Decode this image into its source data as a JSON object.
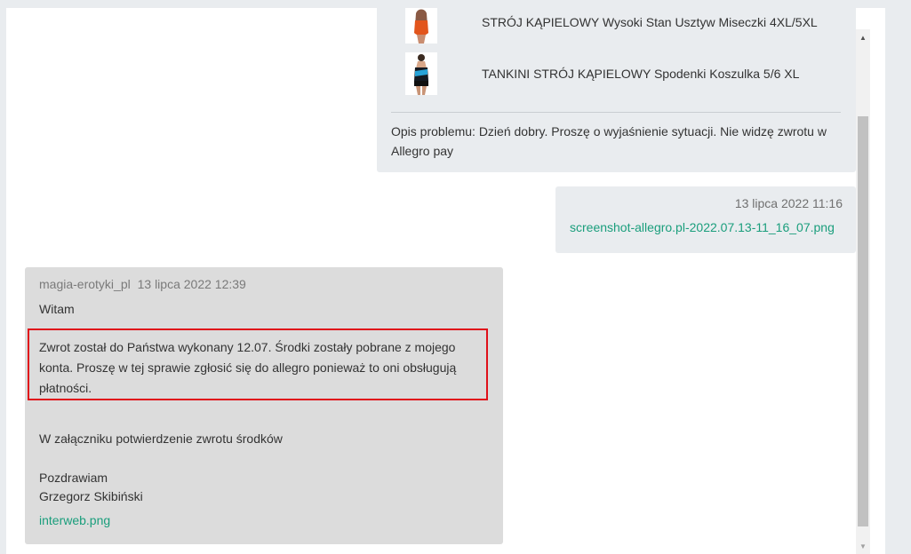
{
  "thread": {
    "buyer_message": {
      "products": [
        {
          "name": "STRÓJ KĄPIELOWY Wysoki Stan Usztyw Miseczki 4XL/5XL",
          "thumb_icon": "swimsuit-orange-thumbnail"
        },
        {
          "name": "TANKINI STRÓJ KĄPIELOWY Spodenki Koszulka 5/6 XL",
          "thumb_icon": "tankini-blue-thumbnail"
        }
      ],
      "problem_text": "Opis problemu: Dzień dobry. Proszę o wyjaśnienie sytuacji. Nie widzę zwrotu w Allegro pay"
    },
    "buyer_attachment": {
      "date": "13 lipca 2022 11:16",
      "file": "screenshot-allegro.pl-2022.07.13-11_16_07.png"
    },
    "seller_message": {
      "author": "magia-erotyki_pl",
      "date": "13 lipca 2022 12:39",
      "greeting": "Witam",
      "highlighted_text": "Zwrot został do Państwa wykonany 12.07. Środki zostały pobrane z mojego konta. Proszę w tej sprawie zgłosić się do allegro ponieważ to oni obsługują płatności.",
      "attachment_note": "W załączniku potwierdzenie zwrotu środków",
      "closing": "Pozdrawiam",
      "signature": "Grzegorz Skibiński",
      "file": "interweb.png"
    }
  },
  "colors": {
    "link": "#1a9e7c",
    "highlight_border": "#e0101a",
    "seller_bubble": "#dcdcdc",
    "buyer_bubble": "#e9ecef"
  }
}
